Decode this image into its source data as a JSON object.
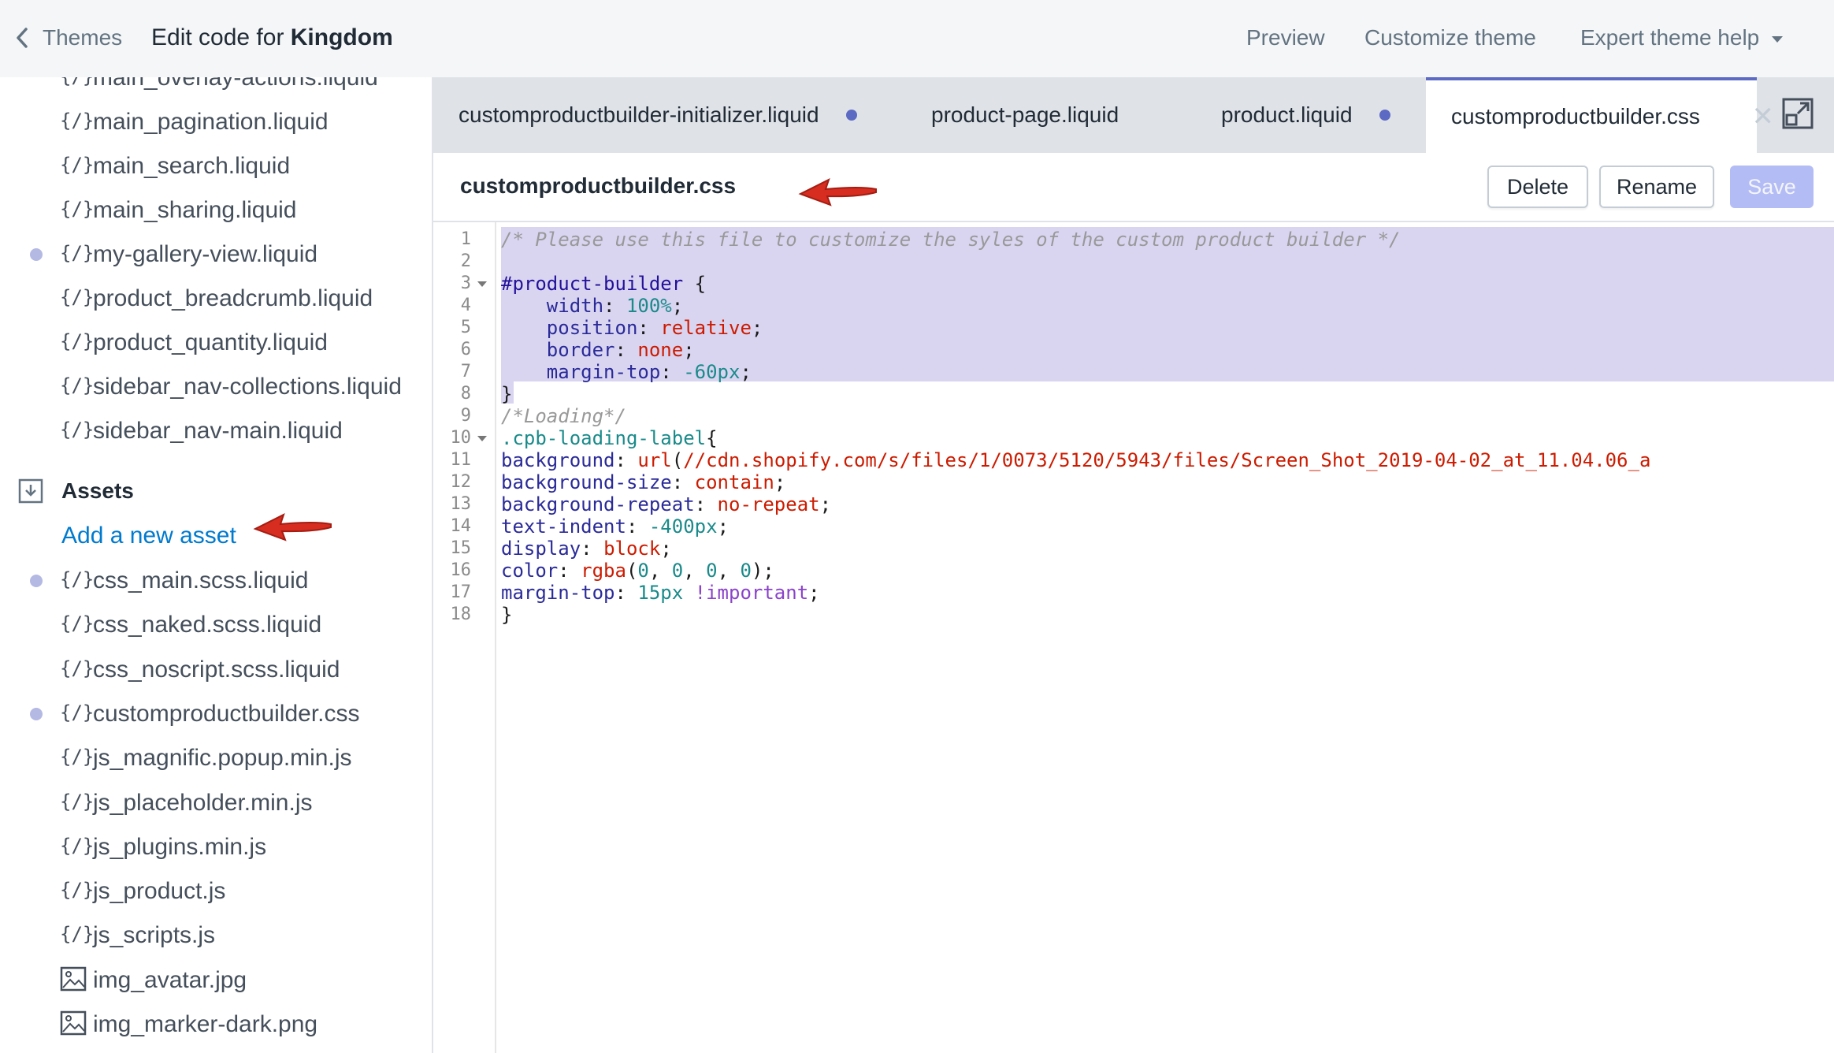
{
  "topbar": {
    "back_label": "Themes",
    "title_prefix": "Edit code for ",
    "theme_name": "Kingdom",
    "preview": "Preview",
    "customize": "Customize theme",
    "help": "Expert theme help"
  },
  "sidebar": {
    "snippets": [
      {
        "name": "main_overlay-actions.liquid",
        "dot": false
      },
      {
        "name": "main_pagination.liquid",
        "dot": false
      },
      {
        "name": "main_search.liquid",
        "dot": false
      },
      {
        "name": "main_sharing.liquid",
        "dot": false
      },
      {
        "name": "my-gallery-view.liquid",
        "dot": true
      },
      {
        "name": "product_breadcrumb.liquid",
        "dot": false
      },
      {
        "name": "product_quantity.liquid",
        "dot": false
      },
      {
        "name": "sidebar_nav-collections.liquid",
        "dot": false
      },
      {
        "name": "sidebar_nav-main.liquid",
        "dot": false
      }
    ],
    "assets_heading": "Assets",
    "add_asset": "Add a new asset",
    "assets": [
      {
        "name": "css_main.scss.liquid",
        "dot": true,
        "icon": "code-icon"
      },
      {
        "name": "css_naked.scss.liquid",
        "dot": false,
        "icon": "code-icon"
      },
      {
        "name": "css_noscript.scss.liquid",
        "dot": false,
        "icon": "code-icon"
      },
      {
        "name": "customproductbuilder.css",
        "dot": true,
        "icon": "code-icon"
      },
      {
        "name": "js_magnific.popup.min.js",
        "dot": false,
        "icon": "code-icon"
      },
      {
        "name": "js_placeholder.min.js",
        "dot": false,
        "icon": "code-icon"
      },
      {
        "name": "js_plugins.min.js",
        "dot": false,
        "icon": "code-icon"
      },
      {
        "name": "js_product.js",
        "dot": false,
        "icon": "code-icon"
      },
      {
        "name": "js_scripts.js",
        "dot": false,
        "icon": "code-icon"
      },
      {
        "name": "img_avatar.jpg",
        "dot": false,
        "icon": "image-icon"
      },
      {
        "name": "img_marker-dark.png",
        "dot": false,
        "icon": "image-icon"
      }
    ]
  },
  "tabs": [
    {
      "label": "customproductbuilder-initializer.liquid",
      "unsaved": true
    },
    {
      "label": "product-page.liquid",
      "unsaved": false
    },
    {
      "label": "product.liquid",
      "unsaved": true
    },
    {
      "label": "customproductbuilder.css",
      "unsaved": false,
      "active": true
    }
  ],
  "file_header": {
    "filename": "customproductbuilder.css",
    "delete": "Delete",
    "rename": "Rename",
    "save": "Save"
  },
  "editor": {
    "line_numbers": [
      "1",
      "2",
      "3",
      "4",
      "5",
      "6",
      "7",
      "8",
      "9",
      "10",
      "11",
      "12",
      "13",
      "14",
      "15",
      "16",
      "17",
      "18"
    ],
    "tokens": {
      "l1": "/* Please use this file to customize the syles of the custom product builder */",
      "l3_sel": "#product-builder",
      "l3_brace": " {",
      "l4_prop": "    width",
      "l4_val": "100%",
      "l5_prop": "    position",
      "l5_val": "relative",
      "l6_prop": "    border",
      "l6_val": "none",
      "l7_prop": "    margin-top",
      "l7_val": "-60px",
      "l8": "}",
      "l9": "/*Loading*/",
      "l10_sel": ".cpb-loading-label",
      "l10_brace": "{",
      "l11_prop": "background",
      "l11_fn": "url",
      "l11_val": "//cdn.shopify.com/s/files/1/0073/5120/5943/files/Screen_Shot_2019-04-02_at_11.04.06_a",
      "l12_prop": "background-size",
      "l12_val": "contain",
      "l13_prop": "background-repeat",
      "l13_val": "no-repeat",
      "l14_prop": "text-indent",
      "l14_val": "-400px",
      "l15_prop": "display",
      "l15_val": "block",
      "l16_prop": "color",
      "l16_fn": "rgba",
      "l16_a": "0",
      "l16_b": "0",
      "l16_c": "0",
      "l16_d": "0",
      "l17_prop": "margin-top",
      "l17_val": "15px",
      "l17_imp": "!important",
      "l18": "}"
    }
  },
  "colors": {
    "accent": "#5c6ac4",
    "selection": "#d9d5f1",
    "link": "#007ace",
    "annotation_arrow": "#d62d20"
  }
}
